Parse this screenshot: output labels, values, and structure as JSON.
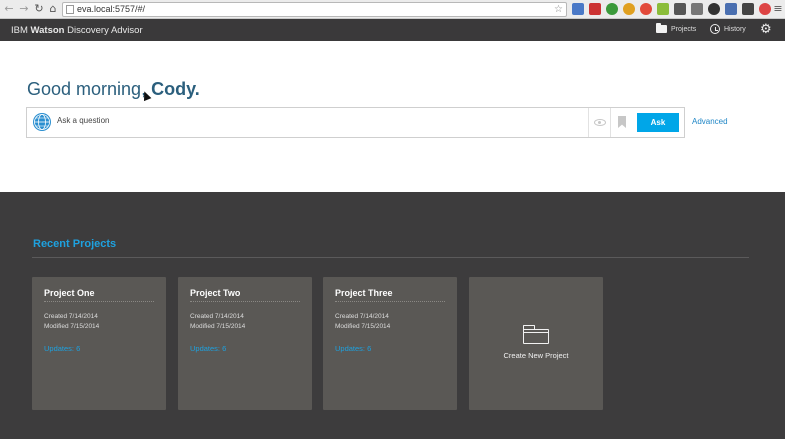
{
  "browser": {
    "url": "eva.local:5757/#/"
  },
  "app": {
    "brand_light_pre": "IBM ",
    "brand_bold": "Watson",
    "brand_rest": " Discovery Advisor",
    "projects_label": "Projects",
    "history_label": "History"
  },
  "hero": {
    "greeting_prefix": "Good morning, ",
    "user_name": "Cody.",
    "search_placeholder": "Ask a question",
    "ask_label": "Ask",
    "advanced_label": "Advanced"
  },
  "recent": {
    "title": "Recent Projects",
    "projects": [
      {
        "name": "Project One",
        "created": "Created 7/14/2014",
        "modified": "Modified 7/15/2014",
        "updates": "Updates: 6"
      },
      {
        "name": "Project Two",
        "created": "Created 7/14/2014",
        "modified": "Modified 7/15/2014",
        "updates": "Updates: 6"
      },
      {
        "name": "Project Three",
        "created": "Created 7/14/2014",
        "modified": "Modified 7/15/2014",
        "updates": "Updates: 6"
      }
    ],
    "new_project_label": "Create New Project"
  },
  "icons": {
    "projects": "folder-icon",
    "history": "clock-icon",
    "settings": "gear-icon",
    "watson": "globe-icon",
    "preview": "eye-icon",
    "bookmark": "bookmark-icon"
  },
  "colors": {
    "accent": "#00a6e8",
    "greeting": "#2b5f7d",
    "dark_bg": "#3d3c3d",
    "card_bg": "#5a5855"
  }
}
